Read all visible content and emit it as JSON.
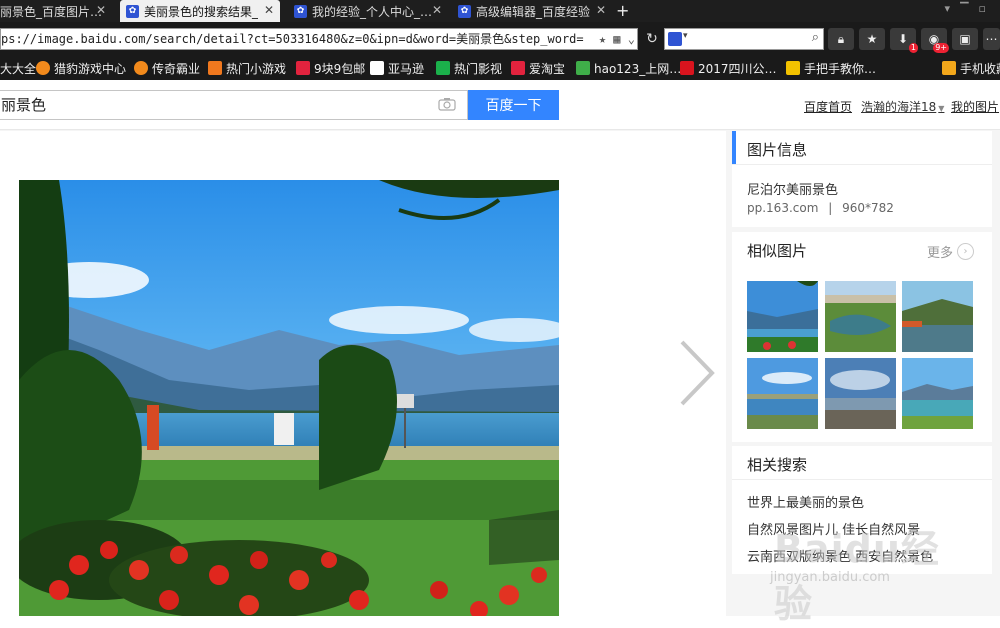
{
  "browser": {
    "tabs": [
      {
        "label": "丽景色_百度图片…",
        "active": false
      },
      {
        "label": "美丽景色的搜索结果_",
        "active": true
      },
      {
        "label": "我的经验_个人中心_…",
        "active": false
      },
      {
        "label": "高级编辑器_百度经验",
        "active": false
      }
    ],
    "new_tab": "+",
    "url": "ps://image.baidu.com/search/detail?ct=503316480&z=0&ipn=d&word=美丽景色&step_word=",
    "badges": {
      "downloads": "1",
      "apps": "9+"
    },
    "bookmarks": [
      {
        "label": "大大全",
        "color": "#1a1a1a"
      },
      {
        "label": "猎豹游戏中心",
        "color": "#f28a1c"
      },
      {
        "label": "传奇霸业",
        "color": "#f28a1c"
      },
      {
        "label": "热门小游戏",
        "color": "#f0781e"
      },
      {
        "label": "9块9包邮",
        "color": "#e2233e"
      },
      {
        "label": "亚马逊",
        "color": "#ffffff"
      },
      {
        "label": "热门影视",
        "color": "#1bb14b"
      },
      {
        "label": "爱淘宝",
        "color": "#e2233e"
      },
      {
        "label": "hao123_上网…",
        "color": "#3fae49"
      },
      {
        "label": "2017四川公…",
        "color": "#d9141e"
      },
      {
        "label": "手把手教你…",
        "color": "#f3c200"
      },
      {
        "label": "手机收藏",
        "color": "#f2a71b"
      }
    ]
  },
  "header": {
    "query": "丽景色",
    "search_button": "百度一下",
    "links": {
      "home": "百度首页",
      "user": "浩瀚的海洋18",
      "my_images": "我的图片"
    }
  },
  "sidebar": {
    "info": {
      "title": "图片信息",
      "source_title": "尼泊尔美丽景色",
      "source_site": "pp.163.com",
      "separator": "|",
      "dimensions": "960*782"
    },
    "similar": {
      "title": "相似图片",
      "more": "更多"
    },
    "related": {
      "title": "相关搜索",
      "items": [
        "世界上最美丽的景色",
        "自然风景图片儿  佳长自然风景",
        "云南西双版纳景色  西安自然景色"
      ]
    },
    "watermark": {
      "logo": "Baidu经验",
      "url": "jingyan.baidu.com"
    }
  }
}
